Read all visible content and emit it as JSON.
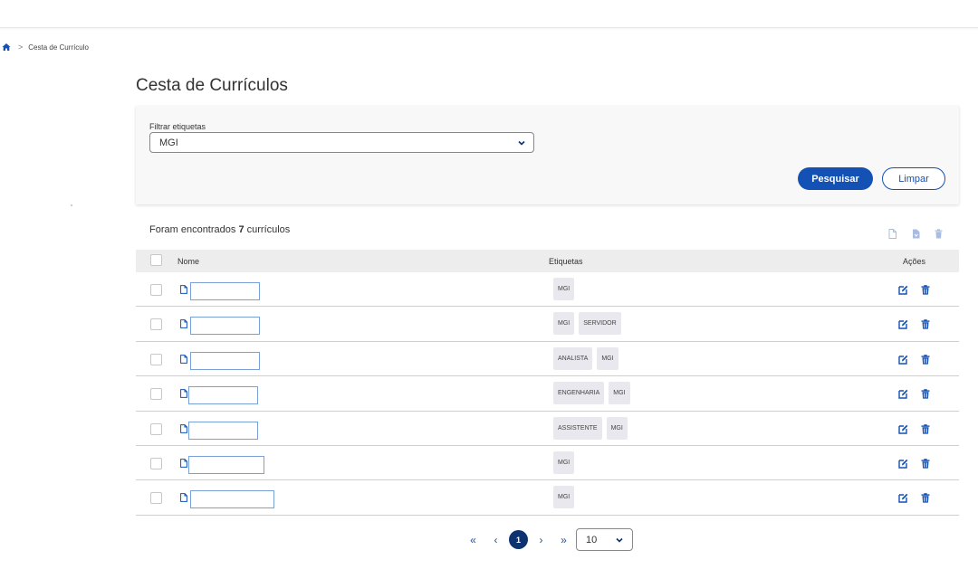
{
  "breadcrumb": {
    "home_icon": "home-icon",
    "separator": ">",
    "current": "Cesta de Currículo"
  },
  "page": {
    "title": "Cesta de Currículos"
  },
  "filter": {
    "label": "Filtrar etiquetas",
    "selected": "MGI",
    "search_label": "Pesquisar",
    "clear_label": "Limpar"
  },
  "results": {
    "prefix": "Foram encontrados ",
    "count": "7",
    "suffix": " currículos"
  },
  "table": {
    "headers": {
      "name": "Nome",
      "tags": "Etiquetas",
      "actions": "Ações"
    },
    "rows": [
      {
        "tags": [
          "MGI"
        ]
      },
      {
        "tags": [
          "MGI",
          "SERVIDOR"
        ]
      },
      {
        "tags": [
          "ANALISTA",
          "MGI"
        ]
      },
      {
        "tags": [
          "ENGENHARIA",
          "MGI"
        ]
      },
      {
        "tags": [
          "ASSISTENTE",
          "MGI"
        ]
      },
      {
        "tags": [
          "MGI"
        ]
      },
      {
        "tags": [
          "MGI"
        ]
      }
    ]
  },
  "pagination": {
    "first": "«",
    "prev": "‹",
    "current": "1",
    "next": "›",
    "last": "»",
    "page_size": "10"
  },
  "colors": {
    "primary": "#1351b4",
    "primary_dark": "#0c326f",
    "tag_bg": "#e8e8ee"
  }
}
